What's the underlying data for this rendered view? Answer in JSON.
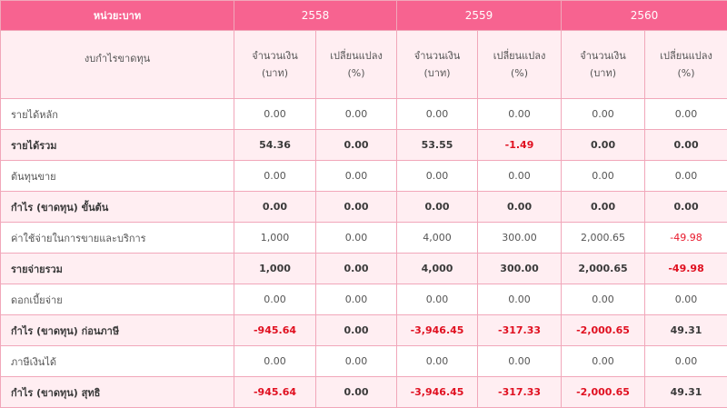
{
  "header": {
    "unit_label": "หน่วย:บาท",
    "years": [
      "2558",
      "2559",
      "2560"
    ],
    "row_label": "งบกำไรขาดทุน",
    "amount_label_1": "จำนวนเงิน",
    "amount_label_2": "(บาท)",
    "change_label_1": "เปลี่ยนแปลง",
    "change_label_2": "(%)"
  },
  "rows": [
    {
      "label": "รายได้หลัก",
      "bold": false,
      "values": [
        "0.00",
        "0.00",
        "0.00",
        "0.00",
        "0.00",
        "0.00"
      ]
    },
    {
      "label": "รายได้รวม",
      "bold": true,
      "values": [
        "54.36",
        "0.00",
        "53.55",
        "-1.49",
        "0.00",
        "0.00"
      ]
    },
    {
      "label": "ต้นทุนขาย",
      "bold": false,
      "values": [
        "0.00",
        "0.00",
        "0.00",
        "0.00",
        "0.00",
        "0.00"
      ]
    },
    {
      "label": "กำไร (ขาดทุน) ขั้นต้น",
      "bold": true,
      "values": [
        "0.00",
        "0.00",
        "0.00",
        "0.00",
        "0.00",
        "0.00"
      ]
    },
    {
      "label": "ค่าใช้จ่ายในการขายและบริการ",
      "bold": false,
      "values": [
        "1,000",
        "0.00",
        "4,000",
        "300.00",
        "2,000.65",
        "-49.98"
      ]
    },
    {
      "label": "รายจ่ายรวม",
      "bold": true,
      "values": [
        "1,000",
        "0.00",
        "4,000",
        "300.00",
        "2,000.65",
        "-49.98"
      ]
    },
    {
      "label": "ดอกเบี้ยจ่าย",
      "bold": false,
      "values": [
        "0.00",
        "0.00",
        "0.00",
        "0.00",
        "0.00",
        "0.00"
      ]
    },
    {
      "label": "กำไร (ขาดทุน) ก่อนภาษี",
      "bold": true,
      "values": [
        "-945.64",
        "0.00",
        "-3,946.45",
        "-317.33",
        "-2,000.65",
        "49.31"
      ]
    },
    {
      "label": "ภาษีเงินได้",
      "bold": false,
      "values": [
        "0.00",
        "0.00",
        "0.00",
        "0.00",
        "0.00",
        "0.00"
      ]
    },
    {
      "label": "กำไร (ขาดทุน) สุทธิ",
      "bold": true,
      "values": [
        "-945.64",
        "0.00",
        "-3,946.45",
        "-317.33",
        "-2,000.65",
        "49.31"
      ]
    }
  ],
  "colors": {
    "header_bg": "#f76390",
    "alt_row_bg": "#ffeef2",
    "border": "#f1a7ba",
    "negative_text": "#e8192c"
  }
}
